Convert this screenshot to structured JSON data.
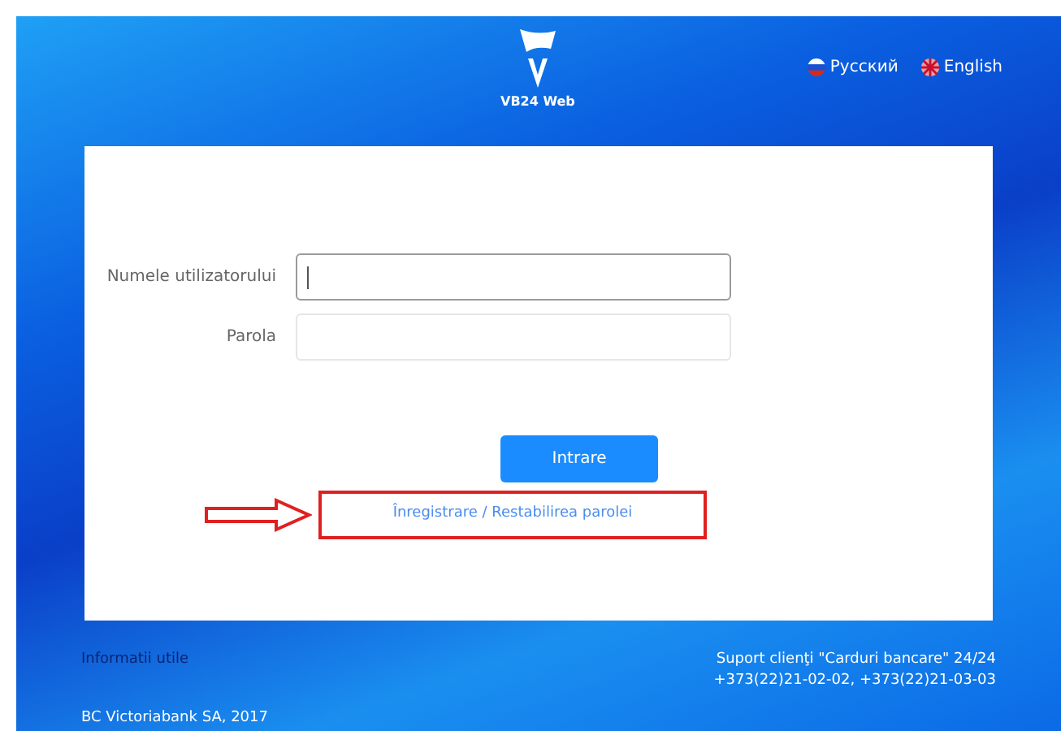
{
  "header": {
    "logo_text": "VB24 Web",
    "languages": [
      {
        "label": "Русский",
        "kind": "ru"
      },
      {
        "label": "English",
        "kind": "en"
      }
    ]
  },
  "login": {
    "fields": [
      {
        "label": "Numele utilizatorului",
        "focused": true
      },
      {
        "label": "Parola",
        "focused": false
      }
    ],
    "submit": "Intrare",
    "link": "Înregistrare / Restabilirea parolei",
    "highlighted": true
  },
  "footer": {
    "info": "Informatii utile",
    "support": [
      "Suport clienţi \"Carduri bancare\" 24/24",
      "+373(22)21-02-02, +373(22)21-03-03"
    ],
    "copyright": "BC Victoriabank SA, 2017"
  }
}
